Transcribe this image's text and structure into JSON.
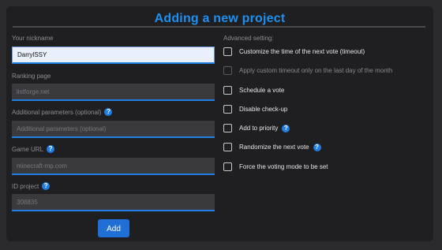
{
  "title": "Adding a new project",
  "nickname": {
    "label": "Your nickname",
    "value": "DarrylSSY"
  },
  "ranking": {
    "label": "Ranking page",
    "placeholder": "listforge.net"
  },
  "additional": {
    "label": "Additional parameters (optional)",
    "placeholder": "Additional parameters (optional)"
  },
  "game_url": {
    "label": "Game URL",
    "placeholder": "minecraft-mp.com"
  },
  "id_project": {
    "label": "ID project",
    "placeholder": "308835"
  },
  "help_glyph": "?",
  "add_button": "Add",
  "advanced": {
    "label": "Advanced setting:",
    "options": [
      {
        "label": "Customize the time of the next vote (timeout)",
        "enabled": true,
        "help": false
      },
      {
        "label": "Apply custom timeout only on the last day of the month",
        "enabled": false,
        "help": false
      },
      {
        "label": "Schedule a vote",
        "enabled": true,
        "help": false
      },
      {
        "label": "Disable check-up",
        "enabled": true,
        "help": false
      },
      {
        "label": "Add to priority",
        "enabled": true,
        "help": true
      },
      {
        "label": "Randomize the next vote",
        "enabled": true,
        "help": true
      },
      {
        "label": "Force the voting mode to be set",
        "enabled": true,
        "help": false
      }
    ]
  },
  "colors": {
    "accent": "#1f8ff0",
    "button": "#1f6fd6",
    "panel": "#1f1f22",
    "background": "#2b2b2e"
  }
}
